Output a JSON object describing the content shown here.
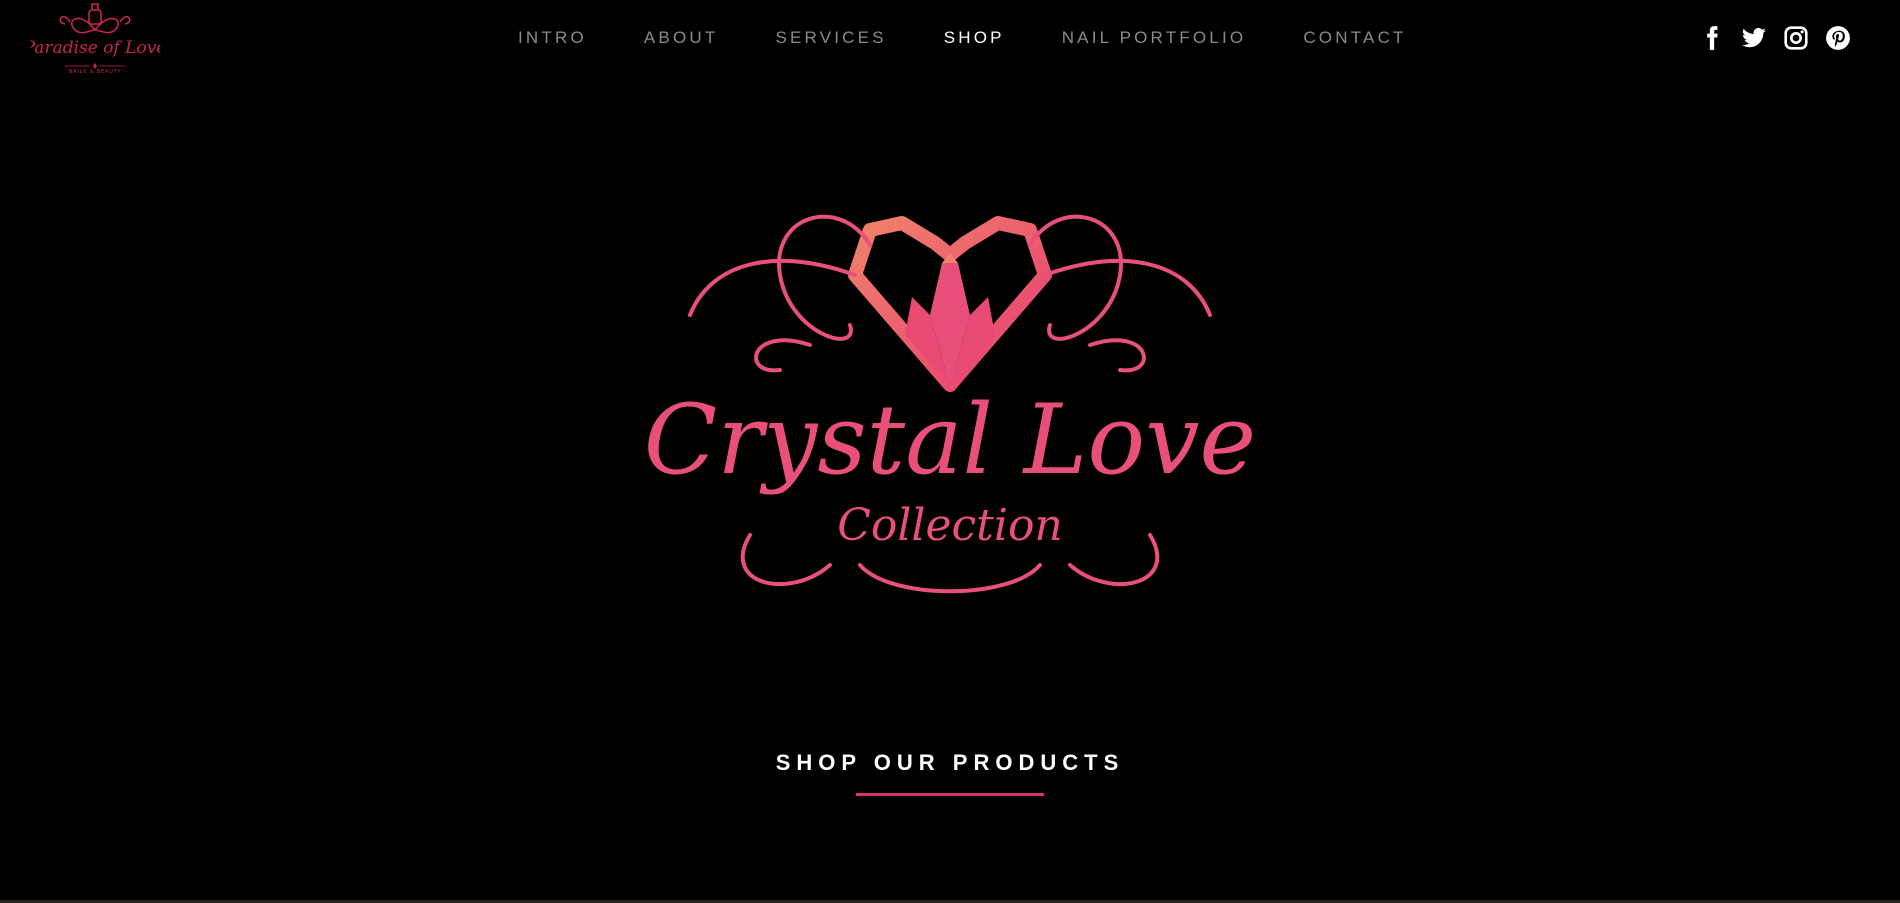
{
  "brand": {
    "logo_text": "Paradise of Love",
    "logo_subtext": "NAILS & BEAUTY",
    "accent_color": "#d8336b"
  },
  "nav": {
    "items": [
      {
        "label": "INTRO",
        "active": false
      },
      {
        "label": "ABOUT",
        "active": false
      },
      {
        "label": "SERVICES",
        "active": false
      },
      {
        "label": "SHOP",
        "active": true
      },
      {
        "label": "NAIL PORTFOLIO",
        "active": false
      },
      {
        "label": "CONTACT",
        "active": false
      }
    ]
  },
  "social": {
    "icons": [
      "facebook-icon",
      "twitter-icon",
      "instagram-icon",
      "pinterest-icon"
    ]
  },
  "hero": {
    "logo_title": "Crystal Love",
    "logo_subtitle": "Collection",
    "logo_color": "#e8507a"
  },
  "section": {
    "title": "SHOP OUR PRODUCTS"
  }
}
